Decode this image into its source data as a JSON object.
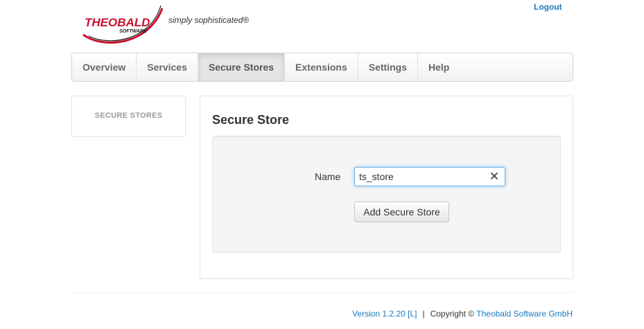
{
  "header": {
    "logo": {
      "brand": "THEOBALD",
      "sub": "SOFTWARE",
      "tagline": "simply sophisticated®"
    },
    "logout_label": "Logout"
  },
  "nav": {
    "items": [
      {
        "label": "Overview"
      },
      {
        "label": "Services"
      },
      {
        "label": "Secure Stores",
        "active": true
      },
      {
        "label": "Extensions"
      },
      {
        "label": "Settings"
      },
      {
        "label": "Help"
      }
    ]
  },
  "sidebar": {
    "header": "SECURE STORES"
  },
  "main": {
    "title": "Secure Store",
    "form": {
      "name_label": "Name",
      "name_value": "ts_store",
      "submit_label": "Add Secure Store"
    }
  },
  "footer": {
    "version": "Version 1.2.20 [L]",
    "separator": "|",
    "copyright_prefix": "Copyright ©",
    "company": "Theobald Software GmbH"
  },
  "colors": {
    "accent_link": "#1a7abf",
    "brand_red": "#c8102e",
    "focus_border": "#66afe9"
  }
}
